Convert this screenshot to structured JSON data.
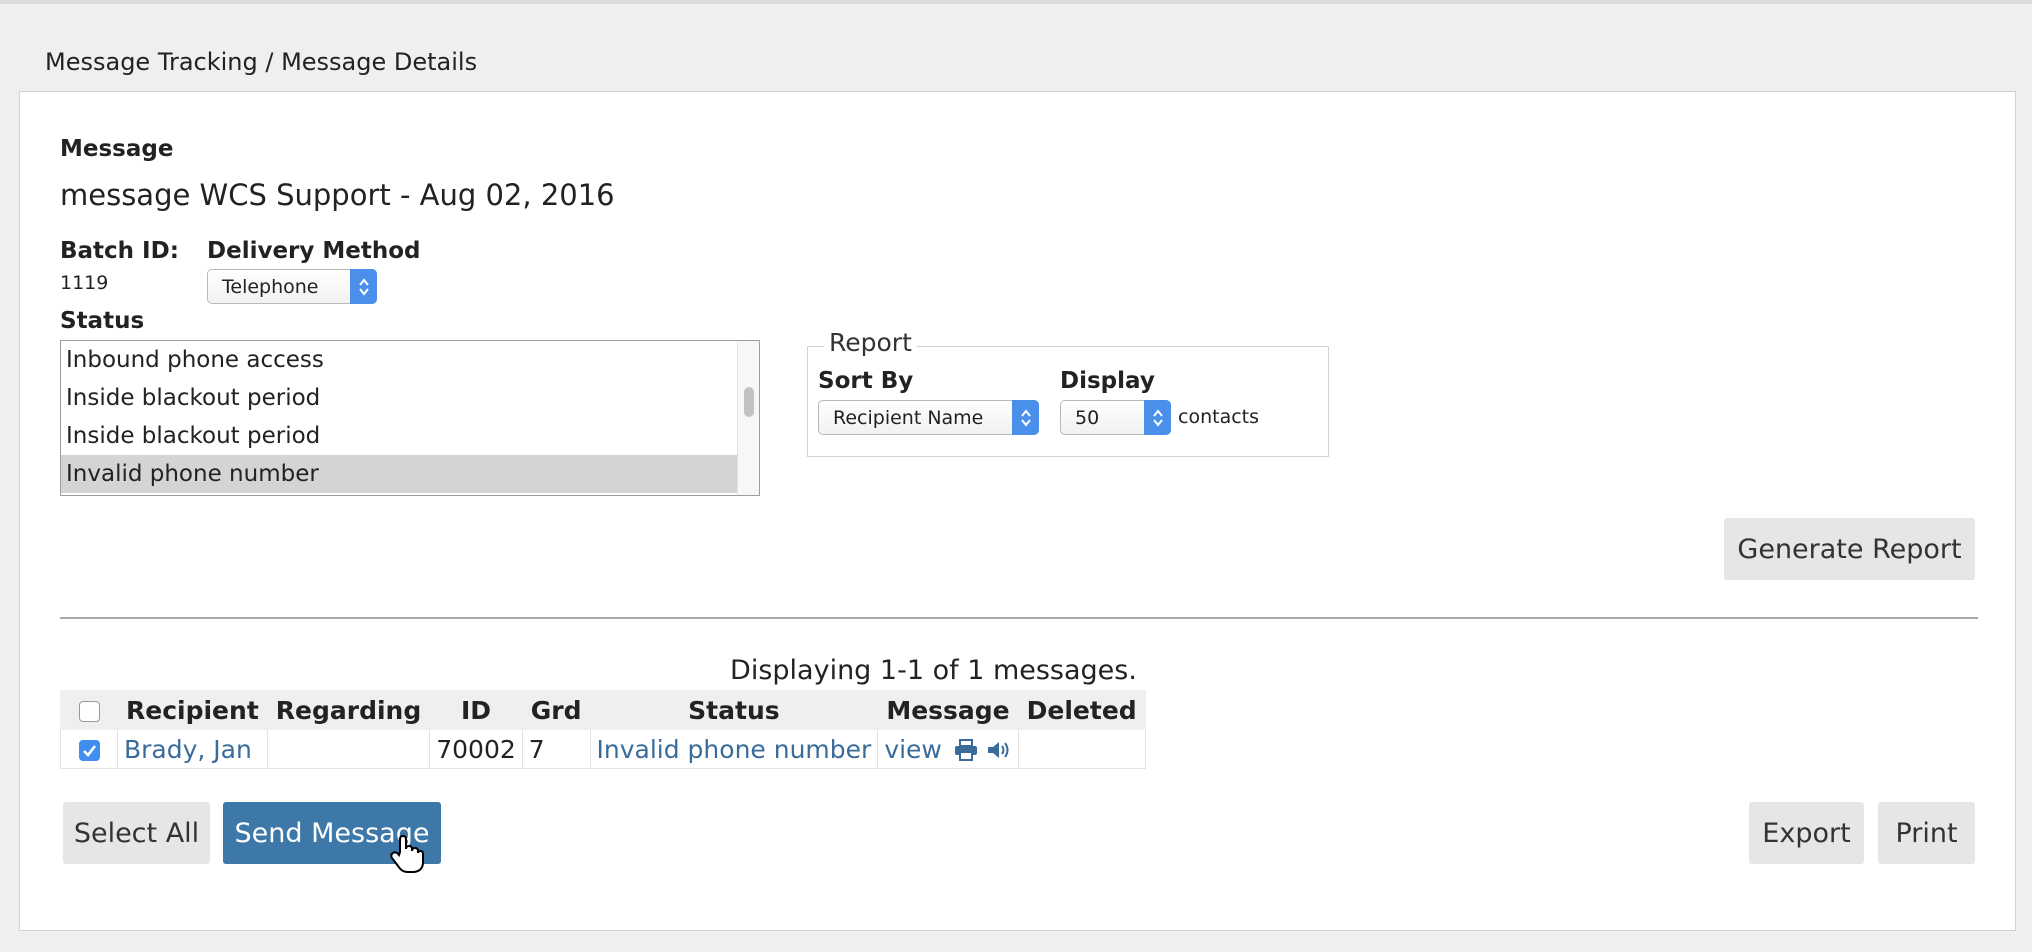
{
  "breadcrumb": "Message Tracking / Message Details",
  "message": {
    "label": "Message",
    "title": "message WCS Support - Aug 02, 2016"
  },
  "batch": {
    "label": "Batch ID:",
    "value": "1119"
  },
  "delivery": {
    "label": "Delivery Method",
    "selected": "Telephone"
  },
  "status": {
    "label": "Status",
    "options": [
      {
        "text": "Inbound phone access",
        "selected": false
      },
      {
        "text": "Inside blackout period",
        "selected": false
      },
      {
        "text": "Inside blackout period",
        "selected": false
      },
      {
        "text": "Invalid phone number",
        "selected": true
      }
    ]
  },
  "report": {
    "legend": "Report",
    "sort_label": "Sort By",
    "sort_selected": "Recipient Name",
    "display_label": "Display",
    "display_selected": "50",
    "display_suffix": "contacts",
    "generate_label": "Generate Report"
  },
  "results": {
    "summary": "Displaying 1-1 of 1 messages.",
    "headers": [
      "Recipient",
      "Regarding",
      "ID",
      "Grd",
      "Status",
      "Message",
      "Deleted"
    ],
    "rows": [
      {
        "checked": true,
        "recipient": "Brady, Jan",
        "regarding": "",
        "id": "70002",
        "grd": "7",
        "status": "Invalid phone number",
        "message": "view",
        "deleted": ""
      }
    ]
  },
  "actions": {
    "select_all": "Select All",
    "send_message": "Send Message",
    "export": "Export",
    "print": "Print"
  },
  "colors": {
    "accent": "#4a8fe9",
    "primary_button": "#3d78a8",
    "link": "#3a6c9b",
    "checkbox": "#3f8ef0"
  },
  "icons": [
    "print-icon",
    "speaker-icon",
    "updown-arrows-icon",
    "check-icon",
    "hand-cursor-icon"
  ]
}
